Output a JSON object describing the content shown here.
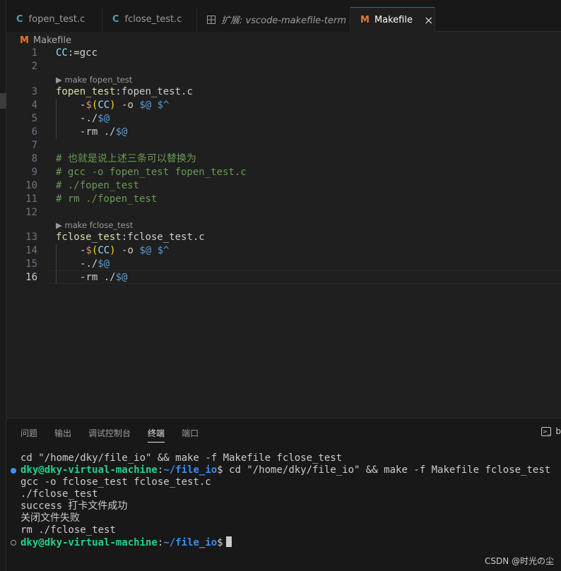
{
  "tabs": [
    {
      "label": "fopen_test.c",
      "icon": "c-file-icon"
    },
    {
      "label": "fclose_test.c",
      "icon": "c-file-icon"
    },
    {
      "label": "扩展: vscode-makefile-term",
      "icon": "extension-icon"
    },
    {
      "label": "Makefile",
      "icon": "makefile-icon",
      "active": true
    }
  ],
  "icons": {
    "c": "C",
    "m": "M",
    "close": "×"
  },
  "breadcrumb": {
    "file": "Makefile"
  },
  "editor": {
    "line_numbers": [
      "1",
      "2",
      "3",
      "4",
      "5",
      "6",
      "7",
      "8",
      "9",
      "10",
      "11",
      "12",
      "13",
      "14",
      "15",
      "16"
    ],
    "lens_1": "▶ make fopen_test",
    "lens_2": "▶ make fclose_test",
    "l1_var": "CC",
    "l1_rest": ":=gcc",
    "l3_target": "fopen_test",
    "l3_colon": ":",
    "l3_dep": "fopen_test.c",
    "l4_dash": "-",
    "l4_dollar": "$",
    "l4_open": "(",
    "l4_cc": "CC",
    "l4_close": ")",
    "l4_opt": " -o ",
    "l4_out": "$@",
    "l4_sp": " ",
    "l4_in": "$^",
    "l5_dash": "-",
    "l5_cmd": "./",
    "l5_auto": "$@",
    "l6_dash": "-",
    "l6_cmd": "rm ./",
    "l6_auto": "$@",
    "l8": "# 也就是说上述三条可以替换为",
    "l9": "# gcc -o fopen_test fopen_test.c",
    "l10": "# ./fopen_test",
    "l11": "# rm ./fopen_test",
    "l13_target": "fclose_test",
    "l13_colon": ":",
    "l13_dep": "fclose_test.c",
    "l14_dash": "-",
    "l14_dollar": "$",
    "l14_open": "(",
    "l14_cc": "CC",
    "l14_close": ")",
    "l14_opt": " -o ",
    "l14_out": "$@",
    "l14_sp": " ",
    "l14_in": "$^",
    "l15_dash": "-",
    "l15_cmd": "./",
    "l15_auto": "$@",
    "l16_dash": "-",
    "l16_cmd": "rm ./",
    "l16_auto": "$@",
    "current_line": 16
  },
  "panel": {
    "tabs": [
      "问题",
      "输出",
      "调试控制台",
      "终端",
      "端口"
    ],
    "active_tab": "终端",
    "right_label": "b"
  },
  "terminal": {
    "line1": "cd \"/home/dky/file_io\" && make -f Makefile fclose_test",
    "prompt_user": "dky@dky-virtual-machine",
    "prompt_colon": ":",
    "prompt_path": "~/file_io",
    "prompt_dollar": "$",
    "line2_cmd": " cd \"/home/dky/file_io\" && make -f Makefile fclose_test",
    "line3": "gcc -o fclose_test fclose_test.c",
    "line4": "./fclose_test",
    "line5": "success 打卡文件成功",
    "line6": "关闭文件失败",
    "line7": "rm ./fclose_test"
  },
  "watermark": "CSDN @时光の尘",
  "colors": {
    "accent": "#0078d4",
    "makefile_icon": "#e37933",
    "c_icon": "#519aba",
    "prompt_user": "#23d18b",
    "prompt_path": "#3b8eea"
  }
}
